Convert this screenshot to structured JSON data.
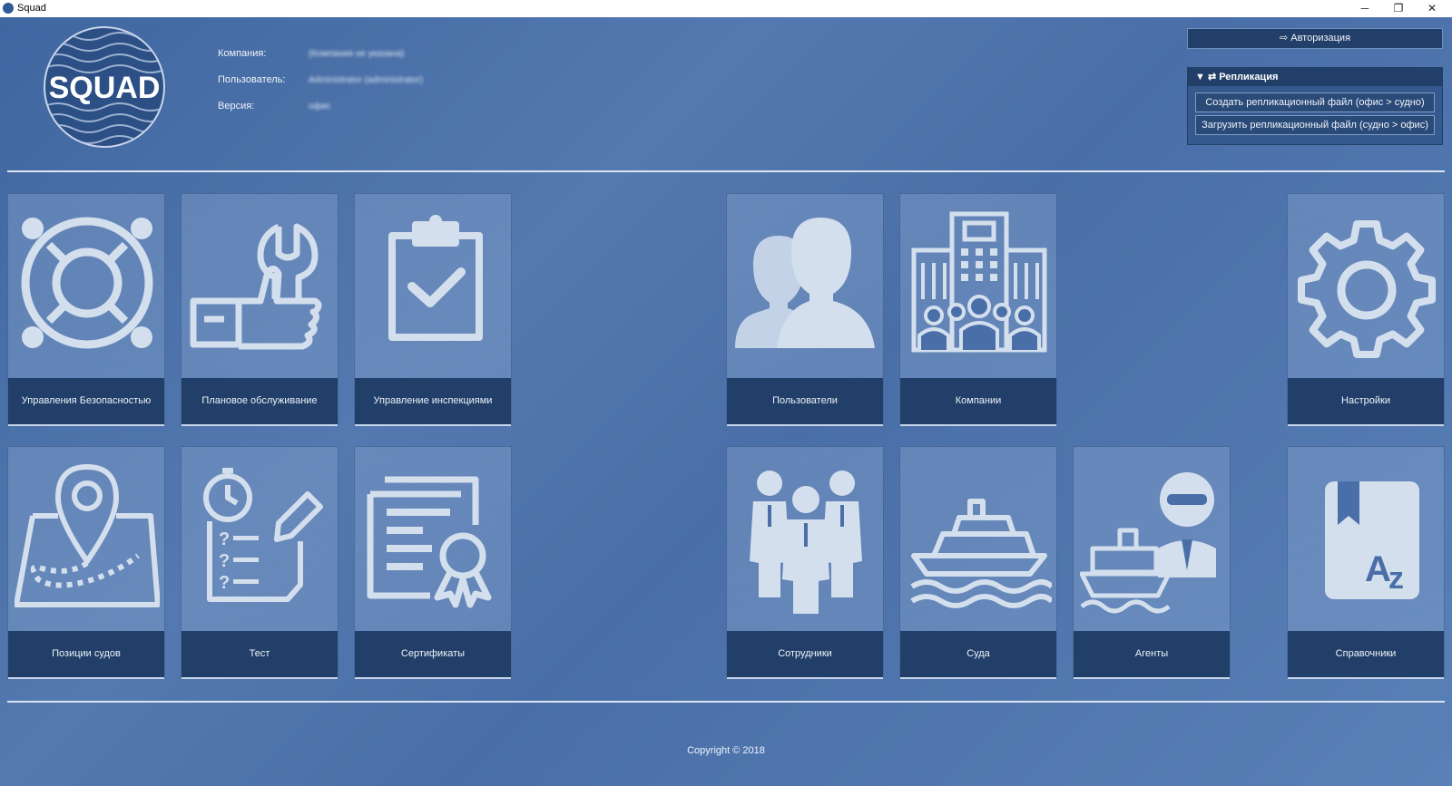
{
  "window": {
    "title": "Squad",
    "minimize": "─",
    "maximize": "❐",
    "close": "✕"
  },
  "logo": {
    "text": "SQUAD"
  },
  "info": {
    "company_label": "Компания:",
    "company_value": "(Компания не указана)",
    "user_label": "Пользователь:",
    "user_value": "Administrator (administrator)",
    "version_label": "Версия:",
    "version_value": "офис"
  },
  "auth": {
    "label": "Авторизация"
  },
  "replication": {
    "title": "Репликация",
    "create_label": "Создать репликационный файл  (офис > судно)",
    "load_label": "Загрузить репликационный файл  (судно > офис)"
  },
  "tiles": {
    "safety": "Управления Безопасностью",
    "maintenance": "Плановое обслуживание",
    "inspections": "Управление инспекциями",
    "users": "Пользователи",
    "companies": "Компании",
    "settings": "Настройки",
    "positions": "Позиции судов",
    "test": "Тест",
    "certificates": "Сертификаты",
    "employees": "Сотрудники",
    "vessels": "Суда",
    "agents": "Агенты",
    "references": "Справочники"
  },
  "footer": {
    "copyright": "Copyright © 2018"
  },
  "colors": {
    "tile_bar": "#213f68",
    "icon": "#d4dfee",
    "background": "#4a6fa8"
  }
}
